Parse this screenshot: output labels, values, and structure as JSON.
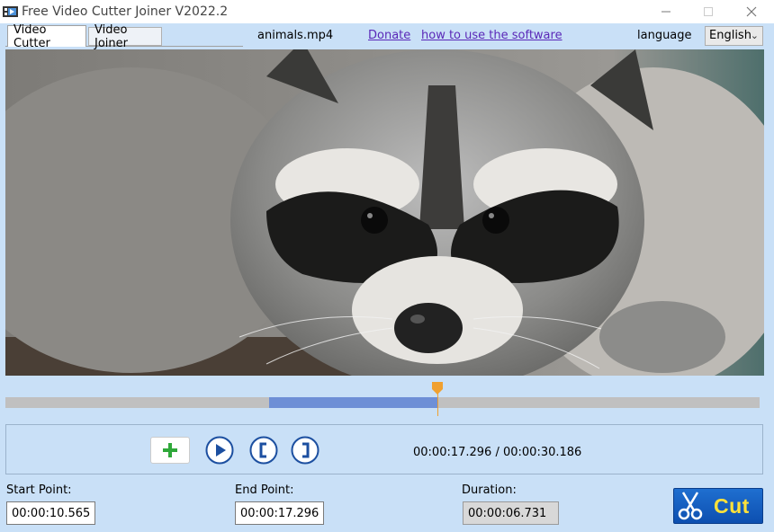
{
  "window": {
    "title": "Free Video Cutter Joiner V2022.2"
  },
  "tabs": [
    {
      "label": "Video Cutter",
      "active": true
    },
    {
      "label": "Video Joiner",
      "active": false
    }
  ],
  "file": {
    "name": "animals.mp4"
  },
  "links": {
    "donate": "Donate",
    "howto": "how to use the software"
  },
  "language": {
    "label": "language",
    "selected": "English"
  },
  "video": {
    "subject": "raccoon"
  },
  "timeline": {
    "selection_start_fraction": 0.35,
    "selection_end_fraction": 0.573,
    "playhead_fraction": 0.573
  },
  "playback": {
    "timecode": "00:00:17.296 / 00:00:30.186"
  },
  "fields": {
    "start_label": "Start Point:",
    "start_value": "00:00:10.565",
    "end_label": "End Point:",
    "end_value": "00:00:17.296",
    "duration_label": "Duration:",
    "duration_value": "00:00:06.731"
  },
  "actions": {
    "cut_label": "Cut"
  },
  "colors": {
    "background": "#c9e0f7",
    "link": "#5a28b8",
    "timeline_selection": "#6e8fd6",
    "playhead": "#f0a030",
    "cut_button": "#1060c8",
    "cut_text": "#ffe23a"
  },
  "icons": {
    "add": "plus-icon",
    "play": "play-icon",
    "mark_in": "bracket-left-icon",
    "mark_out": "bracket-right-icon",
    "cut": "scissors-icon"
  }
}
